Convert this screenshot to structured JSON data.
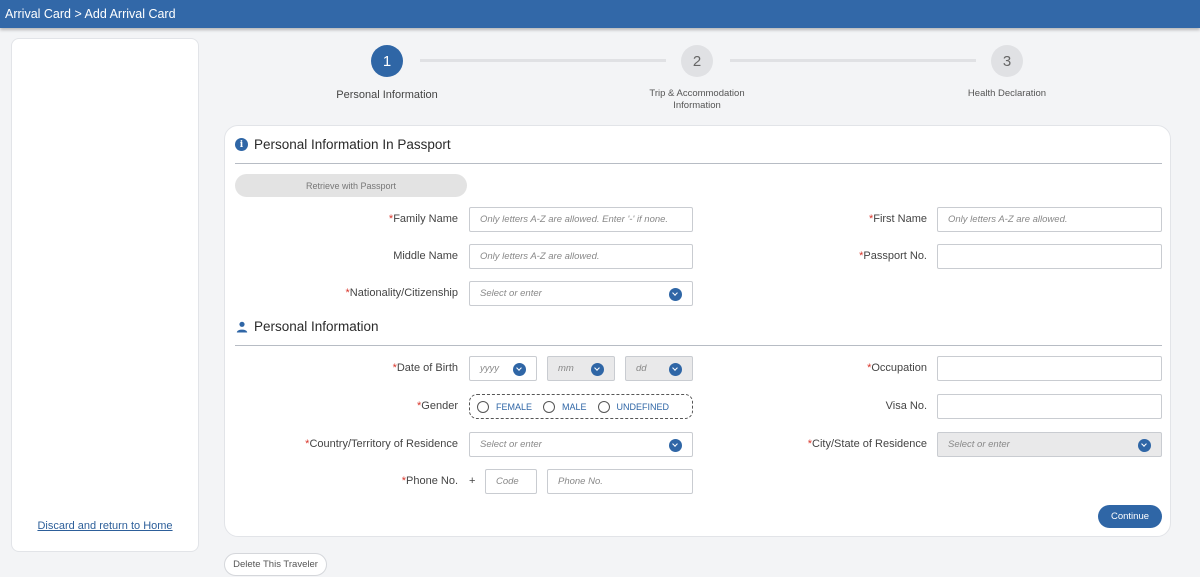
{
  "header": {
    "breadcrumb": "Arrival Card > Add Arrival Card"
  },
  "sidebar": {
    "discard_link": "Discard and return to Home"
  },
  "steps": [
    {
      "number": "1",
      "label": "Personal Information",
      "state": "active"
    },
    {
      "number": "2",
      "label_line1": "Trip & Accommodation",
      "label_line2": "Information",
      "state": "inactive"
    },
    {
      "number": "3",
      "label": "Health Declaration",
      "state": "inactive"
    }
  ],
  "passport_section": {
    "title": "Personal Information In Passport",
    "retrieve_button": "Retrieve with Passport",
    "family_name": {
      "label": "Family Name",
      "required": "*",
      "placeholder": "Only letters A-Z are allowed. Enter '-' if none."
    },
    "first_name": {
      "label": "First Name",
      "required": "*",
      "placeholder": "Only letters A-Z are allowed."
    },
    "middle_name": {
      "label": "Middle Name",
      "placeholder": "Only letters A-Z are allowed."
    },
    "passport_no": {
      "label": "Passport No.",
      "required": "*",
      "placeholder": ""
    },
    "nationality": {
      "label": "Nationality/Citizenship",
      "required": "*",
      "placeholder": "Select or enter"
    }
  },
  "personal_section": {
    "title": "Personal Information",
    "dob": {
      "label": "Date of Birth",
      "required": "*",
      "year_placeholder": "yyyy",
      "month_placeholder": "mm",
      "day_placeholder": "dd"
    },
    "occupation": {
      "label": "Occupation",
      "required": "*",
      "placeholder": ""
    },
    "gender": {
      "label": "Gender",
      "required": "*",
      "options": [
        "FEMALE",
        "MALE",
        "UNDEFINED"
      ]
    },
    "visa_no": {
      "label": "Visa No.",
      "placeholder": ""
    },
    "country_residence": {
      "label": "Country/Territory of Residence",
      "required": "*",
      "placeholder": "Select or enter"
    },
    "city_residence": {
      "label": "City/State of Residence",
      "required": "*",
      "placeholder": "Select or enter"
    },
    "phone": {
      "label": "Phone No.",
      "required": "*",
      "prefix": "+",
      "code_placeholder": "Code",
      "number_placeholder": "Phone No."
    }
  },
  "actions": {
    "continue": "Continue",
    "delete_traveler": "Delete This Traveler"
  },
  "colors": {
    "primary": "#2f66a6",
    "header": "#3268a8",
    "required": "#d9362b"
  }
}
